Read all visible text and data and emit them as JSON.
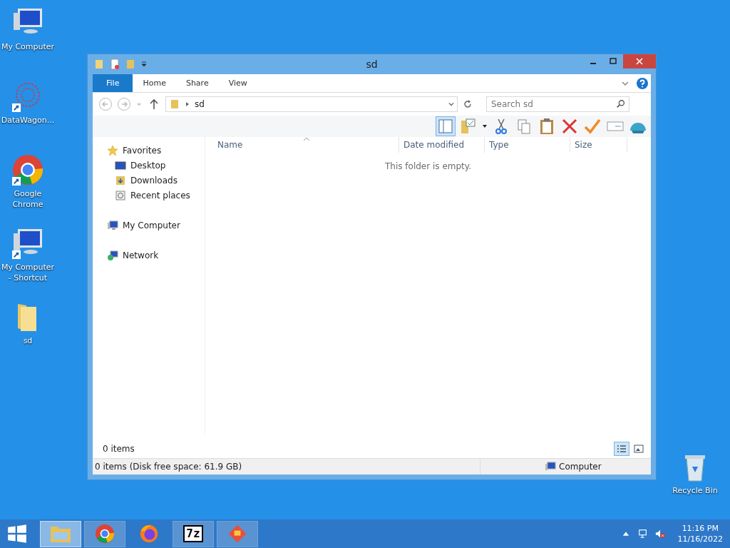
{
  "desktop_icons": [
    {
      "label": "My Computer",
      "kind": "computer",
      "shortcut": false
    },
    {
      "label": "DataWagon...",
      "kind": "app",
      "shortcut": true
    },
    {
      "label": "Google Chrome",
      "kind": "chrome",
      "shortcut": true
    },
    {
      "label": "My Computer - Shortcut",
      "kind": "computer",
      "shortcut": true
    },
    {
      "label": "sd",
      "kind": "folder",
      "shortcut": false
    },
    {
      "label": "Recycle Bin",
      "kind": "bin",
      "shortcut": false
    }
  ],
  "window": {
    "title": "sd",
    "ribbon_tabs": [
      {
        "label": "File",
        "selected": true
      },
      {
        "label": "Home",
        "selected": false
      },
      {
        "label": "Share",
        "selected": false
      },
      {
        "label": "View",
        "selected": false
      }
    ],
    "address": {
      "path": "sd"
    },
    "search": {
      "placeholder": "Search sd"
    },
    "nav_pane": [
      {
        "label": "Favorites",
        "kind": "star",
        "children": [
          {
            "label": "Desktop",
            "kind": "desktop"
          },
          {
            "label": "Downloads",
            "kind": "downloads"
          },
          {
            "label": "Recent places",
            "kind": "recent"
          }
        ]
      },
      {
        "label": "My Computer",
        "kind": "computer"
      },
      {
        "label": "Network",
        "kind": "network"
      }
    ],
    "columns": [
      "Name",
      "Date modified",
      "Type",
      "Size"
    ],
    "empty_message": "This folder is empty.",
    "item_count": "0 items",
    "views": [
      {
        "kind": "details",
        "selected": true
      },
      {
        "kind": "large",
        "selected": false
      }
    ],
    "status_bar": {
      "text": "0 items (Disk free space: 61.9 GB)",
      "location": "Computer"
    }
  },
  "taskbar": {
    "apps": [
      {
        "kind": "explorer",
        "active": true,
        "running": true
      },
      {
        "kind": "chrome",
        "active": false,
        "running": true
      },
      {
        "kind": "firefox",
        "active": false,
        "running": false
      },
      {
        "kind": "sevenzip",
        "label": "7z",
        "active": false,
        "running": true
      },
      {
        "kind": "app",
        "active": false,
        "running": true
      }
    ],
    "time": "11:16 PM",
    "date": "11/16/2022"
  }
}
